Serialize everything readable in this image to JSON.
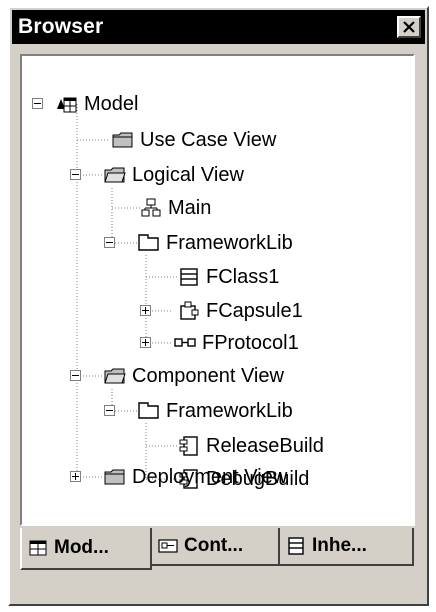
{
  "window": {
    "title": "Browser",
    "close_icon": "close-icon"
  },
  "tree": {
    "nodes": [
      {
        "label": "Model",
        "icon": "model-icon"
      },
      {
        "label": "Use Case View",
        "icon": "folder-icon"
      },
      {
        "label": "Logical View",
        "icon": "folder-open-icon"
      },
      {
        "label": "Main",
        "icon": "class-diagram-icon"
      },
      {
        "label": "FrameworkLib",
        "icon": "package-icon"
      },
      {
        "label": "FClass1",
        "icon": "class-icon"
      },
      {
        "label": "FCapsule1",
        "icon": "capsule-icon"
      },
      {
        "label": "FProtocol1",
        "icon": "protocol-icon"
      },
      {
        "label": "Component View",
        "icon": "folder-open-icon"
      },
      {
        "label": "FrameworkLib",
        "icon": "package-icon"
      },
      {
        "label": "ReleaseBuild",
        "icon": "component-icon"
      },
      {
        "label": "DebugBuild",
        "icon": "component-icon"
      },
      {
        "label": "Deployment View",
        "icon": "folder-icon"
      }
    ]
  },
  "tabs": [
    {
      "label": "Mod...",
      "icon": "model-icon",
      "active": true
    },
    {
      "label": "Cont...",
      "icon": "containment-icon",
      "active": false
    },
    {
      "label": "Inhe...",
      "icon": "inheritance-icon",
      "active": false
    }
  ]
}
